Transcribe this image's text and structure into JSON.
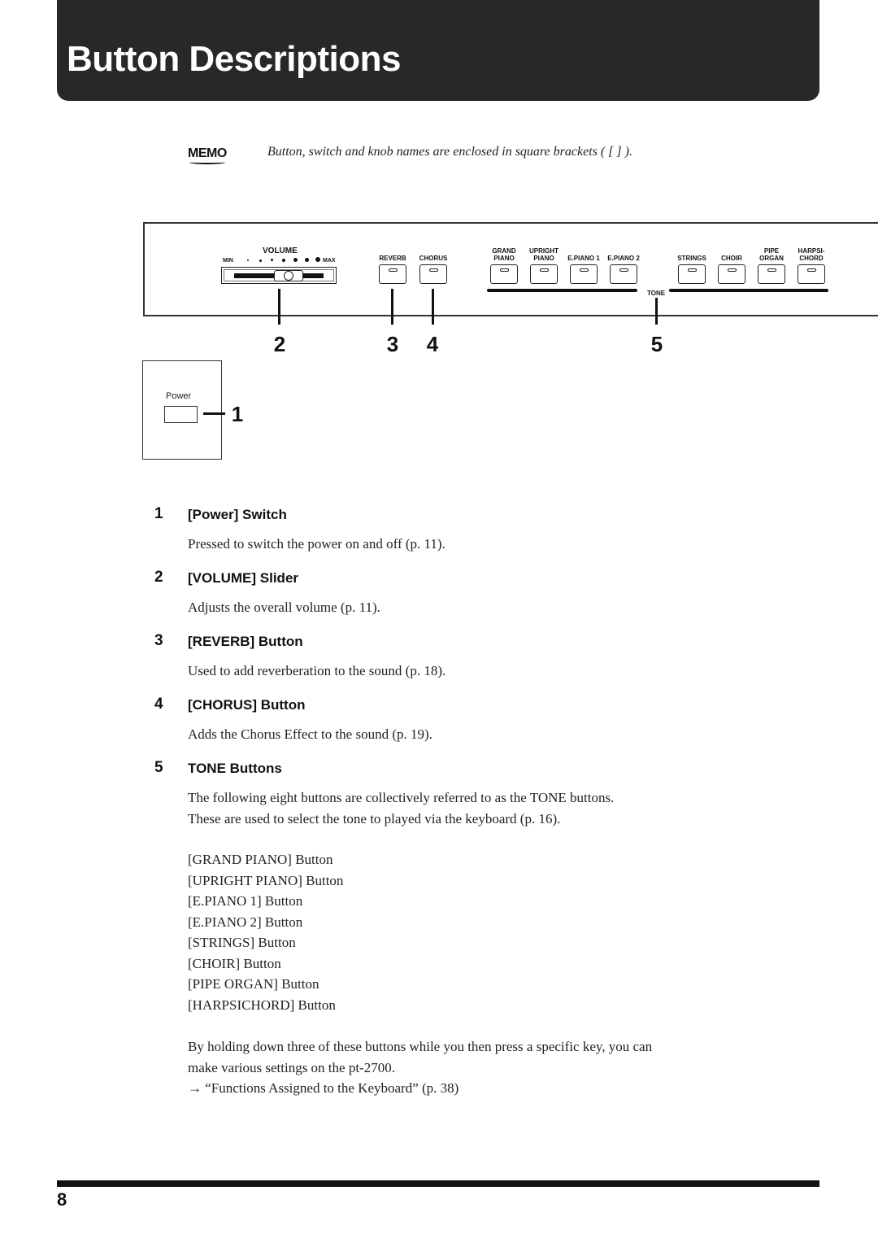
{
  "header": {
    "title": "Button Descriptions"
  },
  "memo": {
    "icon": "memo-icon",
    "icon_text": "MEMO",
    "text": "Button, switch and knob names are enclosed in square brackets ( [ ] )."
  },
  "panel": {
    "volume": {
      "label": "VOLUME",
      "min_label": "MIN",
      "max_label": "MAX"
    },
    "reverb_label": "REVERB",
    "chorus_label": "CHORUS",
    "tone_group_label": "TONE",
    "tone_buttons": [
      {
        "line1": "GRAND",
        "line2": "PIANO"
      },
      {
        "line1": "UPRIGHT",
        "line2": "PIANO"
      },
      {
        "line1": "",
        "line2": "E.PIANO 1"
      },
      {
        "line1": "",
        "line2": "E.PIANO 2"
      },
      {
        "line1": "",
        "line2": "STRINGS"
      },
      {
        "line1": "",
        "line2": "CHOIR"
      },
      {
        "line1": "PIPE",
        "line2": "ORGAN"
      },
      {
        "line1": "HARPSI-",
        "line2": "CHORD"
      }
    ],
    "power_label": "Power"
  },
  "callouts": [
    "1",
    "2",
    "3",
    "4",
    "5"
  ],
  "items": [
    {
      "num": "1",
      "heading": "[Power] Switch",
      "text": "Pressed to switch the power on and off (p. 11)."
    },
    {
      "num": "2",
      "heading": "[VOLUME] Slider",
      "text": "Adjusts the overall volume (p. 11)."
    },
    {
      "num": "3",
      "heading": "[REVERB] Button",
      "text": "Used to add reverberation to the sound (p. 18)."
    },
    {
      "num": "4",
      "heading": "[CHORUS] Button",
      "text": "Adds the Chorus Effect to the sound (p. 19)."
    },
    {
      "num": "5",
      "heading": "TONE Buttons",
      "text_lines": [
        "The following eight buttons are collectively referred to as the TONE buttons.",
        "These are used to select the tone to played via the keyboard (p. 16)."
      ],
      "button_list": [
        "[GRAND PIANO] Button",
        "[UPRIGHT PIANO] Button",
        "[E.PIANO 1] Button",
        "[E.PIANO 2] Button",
        "[STRINGS] Button",
        "[CHOIR] Button",
        "[PIPE ORGAN] Button",
        "[HARPSICHORD] Button"
      ],
      "note_lines": [
        "By holding down three of these buttons while you then press a specific key, you can",
        "make various settings on the pt-2700.",
        "→ “Functions Assigned to the Keyboard” (p. 38)"
      ]
    }
  ],
  "footer": {
    "page_number": "8"
  }
}
